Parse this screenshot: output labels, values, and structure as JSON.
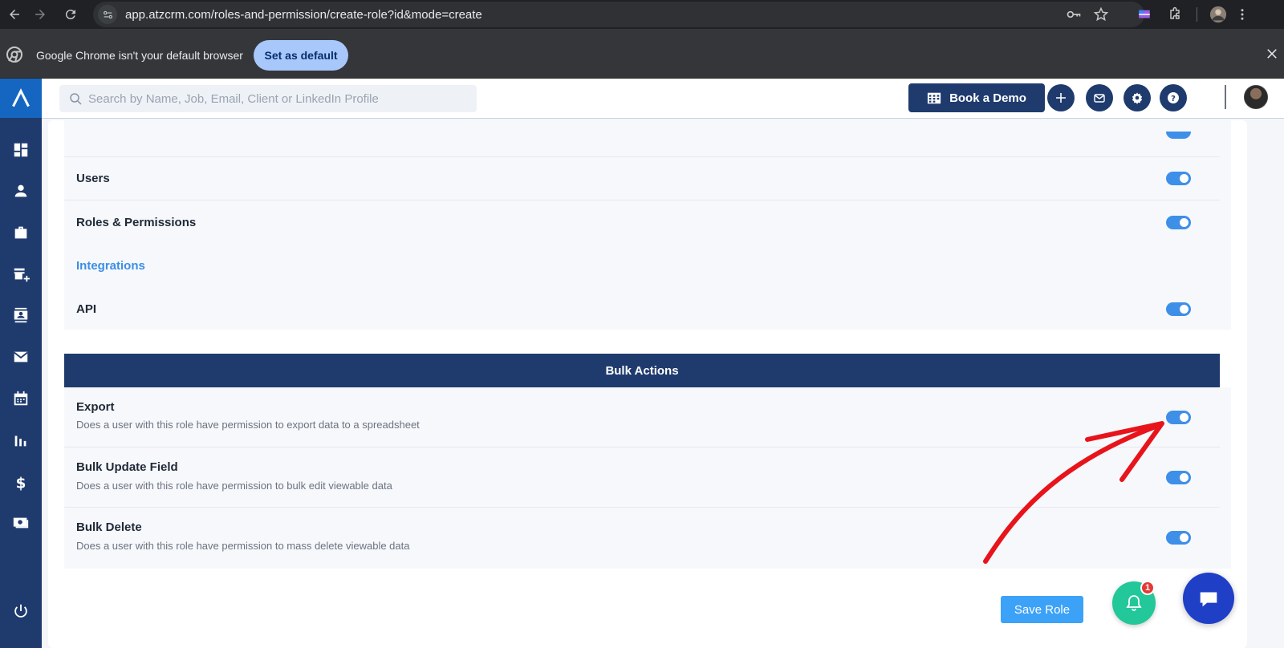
{
  "browser": {
    "url": "app.atzcrm.com/roles-and-permission/create-role?id&mode=create",
    "infobar_text": "Google Chrome isn't your default browser",
    "infobar_button": "Set as default"
  },
  "header": {
    "search_placeholder": "Search by Name, Job, Email, Client or LinkedIn Profile",
    "book_demo_label": "Book a Demo"
  },
  "sidebar": {
    "items": [
      "dashboard",
      "contacts",
      "jobs",
      "clients",
      "candidates",
      "email",
      "calendar",
      "reports",
      "billing",
      "placements"
    ]
  },
  "permissions_top": [
    {
      "title": "Users",
      "enabled": true
    },
    {
      "title": "Roles & Permissions",
      "enabled": true
    }
  ],
  "integrations_label": "Integrations",
  "integrations": [
    {
      "title": "API",
      "enabled": true
    }
  ],
  "bulk_actions": {
    "header": "Bulk Actions",
    "items": [
      {
        "title": "Export",
        "description": "Does a user with this role have permission to export data to a spreadsheet",
        "enabled": true
      },
      {
        "title": "Bulk Update Field",
        "description": "Does a user with this role have permission to bulk edit viewable data",
        "enabled": true
      },
      {
        "title": "Bulk Delete",
        "description": "Does a user with this role have permission to mass delete viewable data",
        "enabled": true
      }
    ]
  },
  "save_button": "Save Role",
  "notification_count": "1",
  "colors": {
    "primary": "#1f3b6e",
    "accent": "#3d8fe8",
    "notify": "#22c79a",
    "annotation": "#e8141b"
  }
}
